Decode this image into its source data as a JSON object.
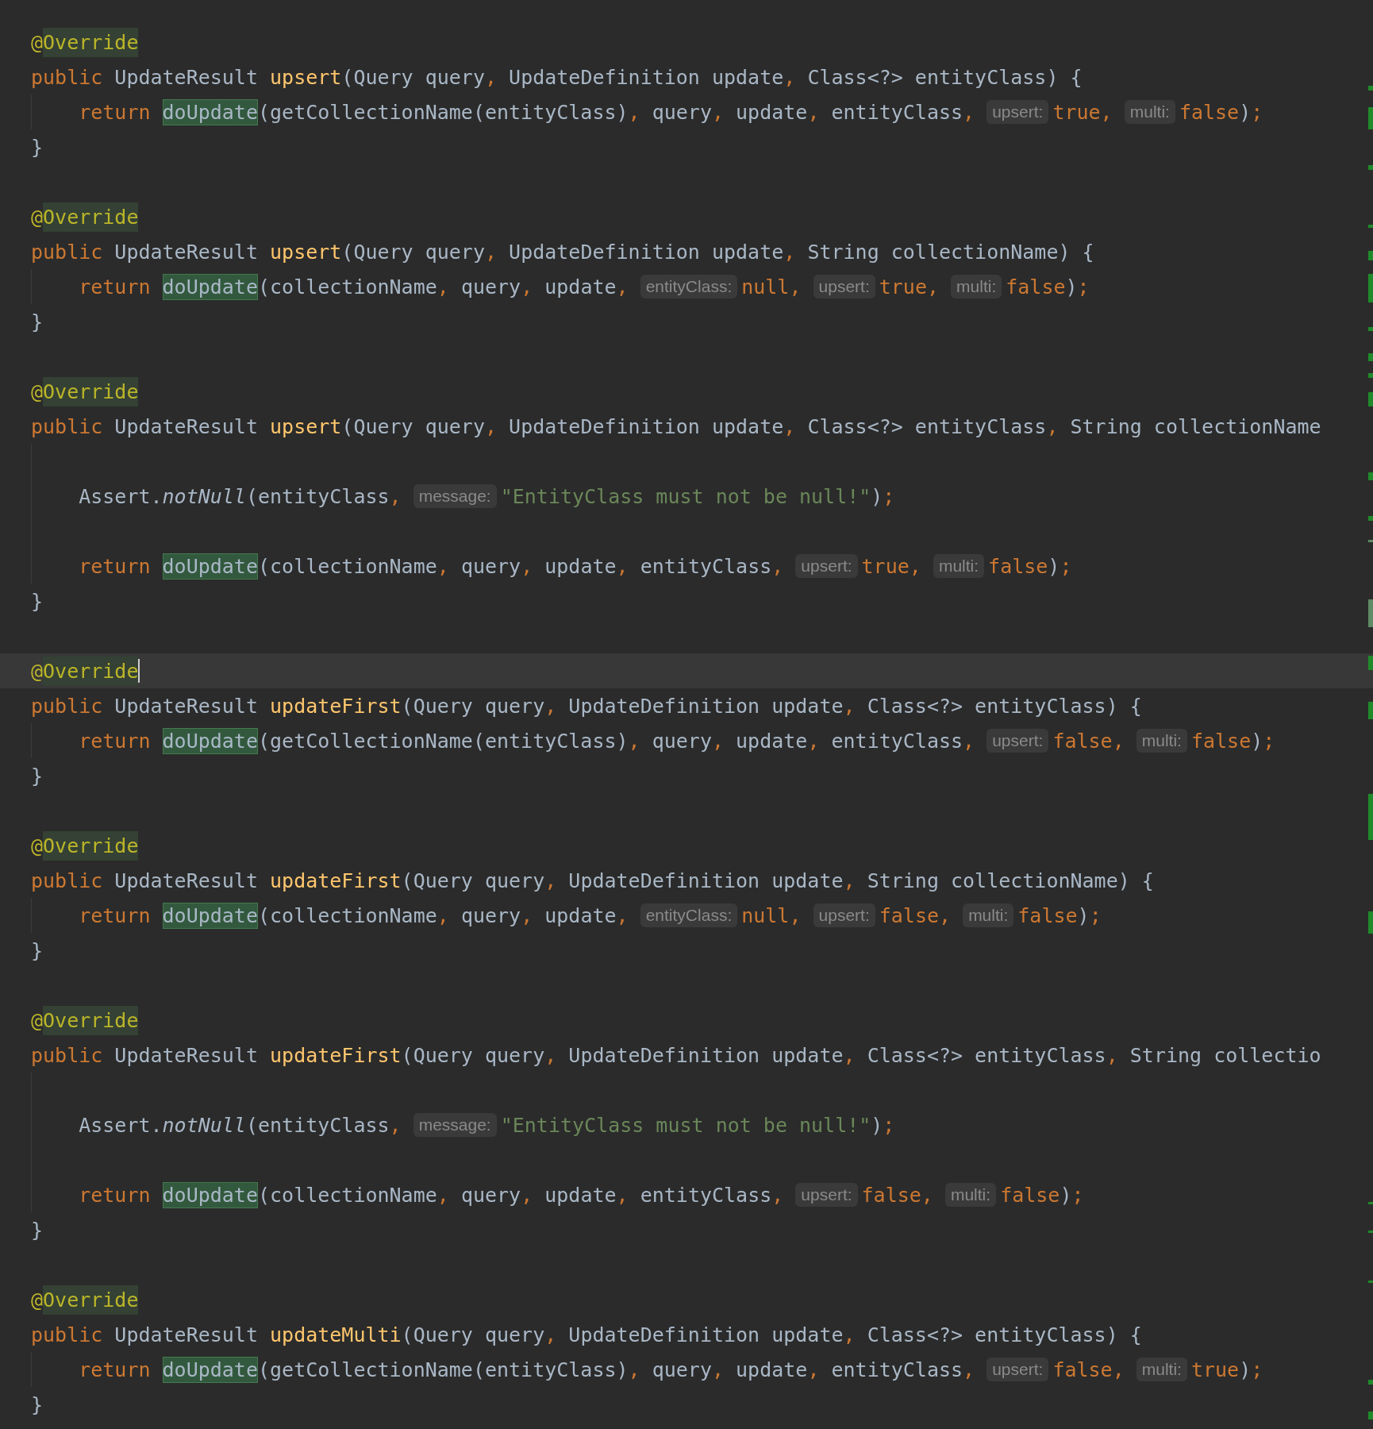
{
  "methods": [
    {
      "annotation": {
        "at": "@",
        "name": "Override",
        "current": false
      },
      "signature": [
        {
          "kind": "kw",
          "text": "public "
        },
        {
          "kind": "t",
          "text": "UpdateResult "
        },
        {
          "kind": "fn",
          "text": "upsert"
        },
        {
          "kind": "t",
          "text": "(Query query"
        },
        {
          "kind": "p",
          "text": ", "
        },
        {
          "kind": "t",
          "text": "UpdateDefinition update"
        },
        {
          "kind": "p",
          "text": ", "
        },
        {
          "kind": "t",
          "text": "Class<?> entityClass) {"
        }
      ],
      "body": [
        {
          "kind": "code",
          "tokens": [
            {
              "kind": "kw",
              "text": "return "
            },
            {
              "kind": "hl",
              "text": "doUpdate"
            },
            {
              "kind": "t",
              "text": "(getCollectionName(entityClass)"
            },
            {
              "kind": "p",
              "text": ", "
            },
            {
              "kind": "t",
              "text": "query"
            },
            {
              "kind": "p",
              "text": ", "
            },
            {
              "kind": "t",
              "text": "update"
            },
            {
              "kind": "p",
              "text": ", "
            },
            {
              "kind": "t",
              "text": "entityClass"
            },
            {
              "kind": "p",
              "text": ", "
            },
            {
              "kind": "hint",
              "text": "upsert:"
            },
            {
              "kind": "kw",
              "text": "true"
            },
            {
              "kind": "p",
              "text": ", "
            },
            {
              "kind": "hint",
              "text": "multi:"
            },
            {
              "kind": "kw",
              "text": "false"
            },
            {
              "kind": "t",
              "text": ")"
            },
            {
              "kind": "p",
              "text": ";"
            }
          ]
        }
      ],
      "close": "}"
    },
    {
      "annotation": {
        "at": "@",
        "name": "Override",
        "current": false
      },
      "signature": [
        {
          "kind": "kw",
          "text": "public "
        },
        {
          "kind": "t",
          "text": "UpdateResult "
        },
        {
          "kind": "fn",
          "text": "upsert"
        },
        {
          "kind": "t",
          "text": "(Query query"
        },
        {
          "kind": "p",
          "text": ", "
        },
        {
          "kind": "t",
          "text": "UpdateDefinition update"
        },
        {
          "kind": "p",
          "text": ", "
        },
        {
          "kind": "t",
          "text": "String collectionName) {"
        }
      ],
      "body": [
        {
          "kind": "code",
          "tokens": [
            {
              "kind": "kw",
              "text": "return "
            },
            {
              "kind": "hl",
              "text": "doUpdate"
            },
            {
              "kind": "t",
              "text": "(collectionName"
            },
            {
              "kind": "p",
              "text": ", "
            },
            {
              "kind": "t",
              "text": "query"
            },
            {
              "kind": "p",
              "text": ", "
            },
            {
              "kind": "t",
              "text": "update"
            },
            {
              "kind": "p",
              "text": ", "
            },
            {
              "kind": "hint",
              "text": "entityClass:"
            },
            {
              "kind": "kw",
              "text": "null"
            },
            {
              "kind": "p",
              "text": ", "
            },
            {
              "kind": "hint",
              "text": "upsert:"
            },
            {
              "kind": "kw",
              "text": "true"
            },
            {
              "kind": "p",
              "text": ", "
            },
            {
              "kind": "hint",
              "text": "multi:"
            },
            {
              "kind": "kw",
              "text": "false"
            },
            {
              "kind": "t",
              "text": ")"
            },
            {
              "kind": "p",
              "text": ";"
            }
          ]
        }
      ],
      "close": "}"
    },
    {
      "annotation": {
        "at": "@",
        "name": "Override",
        "current": false
      },
      "signature": [
        {
          "kind": "kw",
          "text": "public "
        },
        {
          "kind": "t",
          "text": "UpdateResult "
        },
        {
          "kind": "fn",
          "text": "upsert"
        },
        {
          "kind": "t",
          "text": "(Query query"
        },
        {
          "kind": "p",
          "text": ", "
        },
        {
          "kind": "t",
          "text": "UpdateDefinition update"
        },
        {
          "kind": "p",
          "text": ", "
        },
        {
          "kind": "t",
          "text": "Class<?> entityClass"
        },
        {
          "kind": "p",
          "text": ", "
        },
        {
          "kind": "t",
          "text": "String collectionName"
        }
      ],
      "body": [
        {
          "kind": "blank"
        },
        {
          "kind": "code",
          "tokens": [
            {
              "kind": "t",
              "text": "Assert."
            },
            {
              "kind": "it",
              "text": "notNull"
            },
            {
              "kind": "t",
              "text": "(entityClass"
            },
            {
              "kind": "p",
              "text": ", "
            },
            {
              "kind": "hint",
              "text": "message:"
            },
            {
              "kind": "str",
              "text": "\"EntityClass must not be null!\""
            },
            {
              "kind": "t",
              "text": ")"
            },
            {
              "kind": "p",
              "text": ";"
            }
          ]
        },
        {
          "kind": "blank"
        },
        {
          "kind": "code",
          "tokens": [
            {
              "kind": "kw",
              "text": "return "
            },
            {
              "kind": "hl",
              "text": "doUpdate"
            },
            {
              "kind": "t",
              "text": "(collectionName"
            },
            {
              "kind": "p",
              "text": ", "
            },
            {
              "kind": "t",
              "text": "query"
            },
            {
              "kind": "p",
              "text": ", "
            },
            {
              "kind": "t",
              "text": "update"
            },
            {
              "kind": "p",
              "text": ", "
            },
            {
              "kind": "t",
              "text": "entityClass"
            },
            {
              "kind": "p",
              "text": ", "
            },
            {
              "kind": "hint",
              "text": "upsert:"
            },
            {
              "kind": "kw",
              "text": "true"
            },
            {
              "kind": "p",
              "text": ", "
            },
            {
              "kind": "hint",
              "text": "multi:"
            },
            {
              "kind": "kw",
              "text": "false"
            },
            {
              "kind": "t",
              "text": ")"
            },
            {
              "kind": "p",
              "text": ";"
            }
          ]
        }
      ],
      "close": "}"
    },
    {
      "annotation": {
        "at": "@",
        "name": "Override",
        "current": true
      },
      "signature": [
        {
          "kind": "kw",
          "text": "public "
        },
        {
          "kind": "t",
          "text": "UpdateResult "
        },
        {
          "kind": "fn",
          "text": "updateFirst"
        },
        {
          "kind": "t",
          "text": "(Query query"
        },
        {
          "kind": "p",
          "text": ", "
        },
        {
          "kind": "t",
          "text": "UpdateDefinition update"
        },
        {
          "kind": "p",
          "text": ", "
        },
        {
          "kind": "t",
          "text": "Class<?> entityClass) {"
        }
      ],
      "body": [
        {
          "kind": "code",
          "tokens": [
            {
              "kind": "kw",
              "text": "return "
            },
            {
              "kind": "hl",
              "text": "doUpdate"
            },
            {
              "kind": "t",
              "text": "(getCollectionName(entityClass)"
            },
            {
              "kind": "p",
              "text": ", "
            },
            {
              "kind": "t",
              "text": "query"
            },
            {
              "kind": "p",
              "text": ", "
            },
            {
              "kind": "t",
              "text": "update"
            },
            {
              "kind": "p",
              "text": ", "
            },
            {
              "kind": "t",
              "text": "entityClass"
            },
            {
              "kind": "p",
              "text": ", "
            },
            {
              "kind": "hint",
              "text": "upsert:"
            },
            {
              "kind": "kw",
              "text": "false"
            },
            {
              "kind": "p",
              "text": ", "
            },
            {
              "kind": "hint",
              "text": "multi:"
            },
            {
              "kind": "kw",
              "text": "false"
            },
            {
              "kind": "t",
              "text": ")"
            },
            {
              "kind": "p",
              "text": ";"
            }
          ]
        }
      ],
      "close": "}"
    },
    {
      "annotation": {
        "at": "@",
        "name": "Override",
        "current": false
      },
      "signature": [
        {
          "kind": "kw",
          "text": "public "
        },
        {
          "kind": "t",
          "text": "UpdateResult "
        },
        {
          "kind": "fn",
          "text": "updateFirst"
        },
        {
          "kind": "t",
          "text": "(Query query"
        },
        {
          "kind": "p",
          "text": ", "
        },
        {
          "kind": "t",
          "text": "UpdateDefinition update"
        },
        {
          "kind": "p",
          "text": ", "
        },
        {
          "kind": "t",
          "text": "String collectionName) {"
        }
      ],
      "body": [
        {
          "kind": "code",
          "tokens": [
            {
              "kind": "kw",
              "text": "return "
            },
            {
              "kind": "hl",
              "text": "doUpdate"
            },
            {
              "kind": "t",
              "text": "(collectionName"
            },
            {
              "kind": "p",
              "text": ", "
            },
            {
              "kind": "t",
              "text": "query"
            },
            {
              "kind": "p",
              "text": ", "
            },
            {
              "kind": "t",
              "text": "update"
            },
            {
              "kind": "p",
              "text": ", "
            },
            {
              "kind": "hint",
              "text": "entityClass:"
            },
            {
              "kind": "kw",
              "text": "null"
            },
            {
              "kind": "p",
              "text": ", "
            },
            {
              "kind": "hint",
              "text": "upsert:"
            },
            {
              "kind": "kw",
              "text": "false"
            },
            {
              "kind": "p",
              "text": ", "
            },
            {
              "kind": "hint",
              "text": "multi:"
            },
            {
              "kind": "kw",
              "text": "false"
            },
            {
              "kind": "t",
              "text": ")"
            },
            {
              "kind": "p",
              "text": ";"
            }
          ]
        }
      ],
      "close": "}"
    },
    {
      "annotation": {
        "at": "@",
        "name": "Override",
        "current": false
      },
      "signature": [
        {
          "kind": "kw",
          "text": "public "
        },
        {
          "kind": "t",
          "text": "UpdateResult "
        },
        {
          "kind": "fn",
          "text": "updateFirst"
        },
        {
          "kind": "t",
          "text": "(Query query"
        },
        {
          "kind": "p",
          "text": ", "
        },
        {
          "kind": "t",
          "text": "UpdateDefinition update"
        },
        {
          "kind": "p",
          "text": ", "
        },
        {
          "kind": "t",
          "text": "Class<?> entityClass"
        },
        {
          "kind": "p",
          "text": ", "
        },
        {
          "kind": "t",
          "text": "String collectio"
        }
      ],
      "body": [
        {
          "kind": "blank"
        },
        {
          "kind": "code",
          "tokens": [
            {
              "kind": "t",
              "text": "Assert."
            },
            {
              "kind": "it",
              "text": "notNull"
            },
            {
              "kind": "t",
              "text": "(entityClass"
            },
            {
              "kind": "p",
              "text": ", "
            },
            {
              "kind": "hint",
              "text": "message:"
            },
            {
              "kind": "str",
              "text": "\"EntityClass must not be null!\""
            },
            {
              "kind": "t",
              "text": ")"
            },
            {
              "kind": "p",
              "text": ";"
            }
          ]
        },
        {
          "kind": "blank"
        },
        {
          "kind": "code",
          "tokens": [
            {
              "kind": "kw",
              "text": "return "
            },
            {
              "kind": "hl",
              "text": "doUpdate"
            },
            {
              "kind": "t",
              "text": "(collectionName"
            },
            {
              "kind": "p",
              "text": ", "
            },
            {
              "kind": "t",
              "text": "query"
            },
            {
              "kind": "p",
              "text": ", "
            },
            {
              "kind": "t",
              "text": "update"
            },
            {
              "kind": "p",
              "text": ", "
            },
            {
              "kind": "t",
              "text": "entityClass"
            },
            {
              "kind": "p",
              "text": ", "
            },
            {
              "kind": "hint",
              "text": "upsert:"
            },
            {
              "kind": "kw",
              "text": "false"
            },
            {
              "kind": "p",
              "text": ", "
            },
            {
              "kind": "hint",
              "text": "multi:"
            },
            {
              "kind": "kw",
              "text": "false"
            },
            {
              "kind": "t",
              "text": ")"
            },
            {
              "kind": "p",
              "text": ";"
            }
          ]
        }
      ],
      "close": "}"
    },
    {
      "annotation": {
        "at": "@",
        "name": "Override",
        "current": false
      },
      "signature": [
        {
          "kind": "kw",
          "text": "public "
        },
        {
          "kind": "t",
          "text": "UpdateResult "
        },
        {
          "kind": "fn",
          "text": "updateMulti"
        },
        {
          "kind": "t",
          "text": "(Query query"
        },
        {
          "kind": "p",
          "text": ", "
        },
        {
          "kind": "t",
          "text": "UpdateDefinition update"
        },
        {
          "kind": "p",
          "text": ", "
        },
        {
          "kind": "t",
          "text": "Class<?> entityClass) {"
        }
      ],
      "body": [
        {
          "kind": "code",
          "tokens": [
            {
              "kind": "kw",
              "text": "return "
            },
            {
              "kind": "hl",
              "text": "doUpdate"
            },
            {
              "kind": "t",
              "text": "(getCollectionName(entityClass)"
            },
            {
              "kind": "p",
              "text": ", "
            },
            {
              "kind": "t",
              "text": "query"
            },
            {
              "kind": "p",
              "text": ", "
            },
            {
              "kind": "t",
              "text": "update"
            },
            {
              "kind": "p",
              "text": ", "
            },
            {
              "kind": "t",
              "text": "entityClass"
            },
            {
              "kind": "p",
              "text": ", "
            },
            {
              "kind": "hint",
              "text": "upsert:"
            },
            {
              "kind": "kw",
              "text": "false"
            },
            {
              "kind": "p",
              "text": ", "
            },
            {
              "kind": "hint",
              "text": "multi:"
            },
            {
              "kind": "kw",
              "text": "true"
            },
            {
              "kind": "t",
              "text": ")"
            },
            {
              "kind": "p",
              "text": ";"
            }
          ]
        }
      ],
      "close": "}"
    }
  ]
}
